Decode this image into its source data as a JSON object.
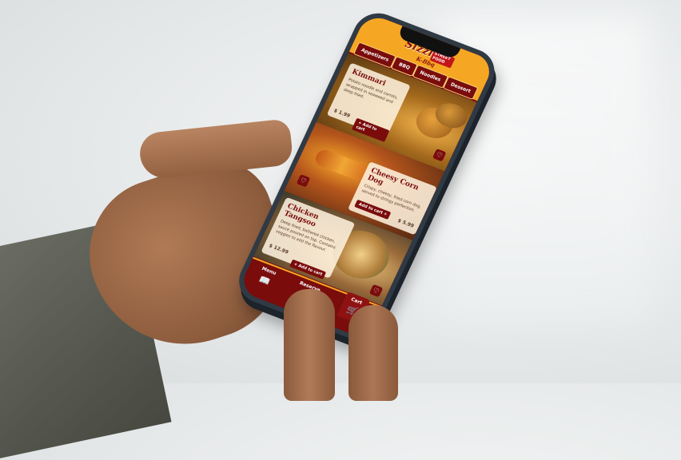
{
  "app": {
    "brand_word": "Sizzly",
    "brand_small": "K-Bbq",
    "brand_tag": "STREET FOOD"
  },
  "tabs": [
    {
      "label": "Appetizers"
    },
    {
      "label": "BBQ"
    },
    {
      "label": "Noodles"
    },
    {
      "label": "Dessert"
    }
  ],
  "items": [
    {
      "title": "Kimmari",
      "description": "Potato noodle and carrots, wrapped in seaweed and deep fried.",
      "price": "$ 1.99",
      "add_label": "Add to cart",
      "favorite_icon": "heart-icon"
    },
    {
      "title": "Cheesy Corn Dog",
      "description": "Crispy, cheesy, fried corn dog, served to stringy perfection.",
      "price": "$ 5.99",
      "add_label": "Add to cart",
      "favorite_icon": "heart-icon"
    },
    {
      "title": "Chicken Tangsoo",
      "description": "Deep fried, battered chicken, sauce poured on top. Contains veggies to add the flavour.",
      "price": "$ 12.99",
      "add_label": "Add to cart",
      "favorite_icon": "heart-icon"
    }
  ],
  "bottom_nav": [
    {
      "label": "Menu",
      "icon": "book-icon"
    },
    {
      "label": "Reserve",
      "icon": "calendar-icon"
    },
    {
      "label": "Cart",
      "icon": "cart-icon"
    }
  ],
  "colors": {
    "header": "#f5a623",
    "accent": "#7a0c0c"
  }
}
